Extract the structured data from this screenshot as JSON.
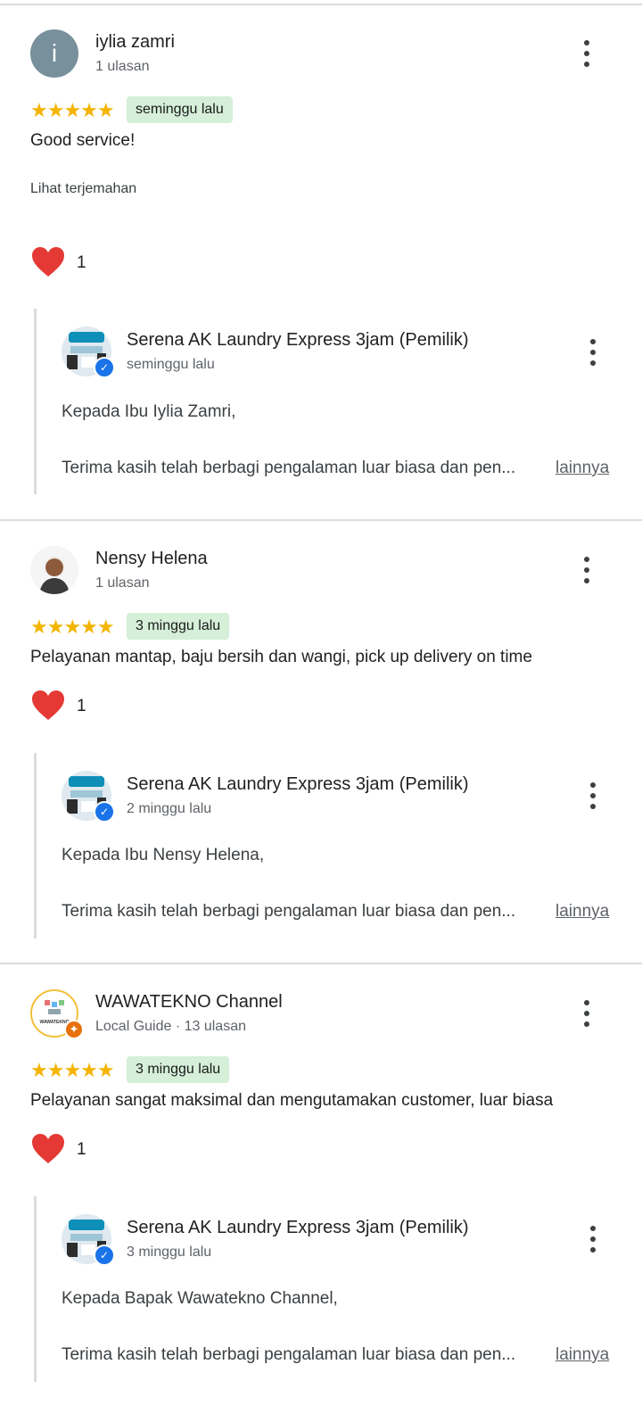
{
  "reviews": [
    {
      "avatar_letter": "i",
      "name": "iylia zamri",
      "meta": "1 ulasan",
      "stars": "★★★★★",
      "time": "seminggu lalu",
      "text": "Good service!",
      "translate": "Lihat terjemahan",
      "reaction_count": "1",
      "reply": {
        "owner": "Serena AK Laundry Express 3jam (Pemilik)",
        "time": "seminggu lalu",
        "greeting": "Kepada Ibu Iylia Zamri,",
        "body": "Terima kasih telah berbagi pengalaman luar biasa dan pen...",
        "more": "lainnya"
      }
    },
    {
      "name": "Nensy Helena",
      "meta": "1 ulasan",
      "stars": "★★★★★",
      "time": "3 minggu lalu",
      "text": "Pelayanan mantap, baju bersih dan wangi, pick up delivery on time",
      "reaction_count": "1",
      "reply": {
        "owner": "Serena AK Laundry Express 3jam (Pemilik)",
        "time": "2 minggu lalu",
        "greeting": "Kepada Ibu Nensy Helena,",
        "body": "Terima kasih telah berbagi pengalaman luar biasa dan pen...",
        "more": "lainnya"
      }
    },
    {
      "name": "WAWATEKNO Channel",
      "meta": "Local Guide · 13 ulasan",
      "avatar_text": "WAWATEKNO",
      "stars": "★★★★★",
      "time": "3 minggu lalu",
      "text": "Pelayanan sangat maksimal dan mengutamakan customer, luar biasa",
      "reaction_count": "1",
      "reply": {
        "owner": "Serena AK Laundry Express 3jam (Pemilik)",
        "time": "3 minggu lalu",
        "greeting": "Kepada Bapak Wawatekno Channel,",
        "body": "Terima kasih telah berbagi pengalaman luar biasa dan pen...",
        "more": "lainnya"
      }
    }
  ],
  "colors": {
    "star": "#f4b400",
    "badge_bg": "#d5efd9",
    "heart": "#e53935",
    "verified": "#1a73e8",
    "local_guide": "#e8710a"
  },
  "icons": {
    "more": "more-vert-icon",
    "heart": "heart-icon",
    "verified": "verified-icon",
    "local_guide": "local-guide-icon"
  }
}
